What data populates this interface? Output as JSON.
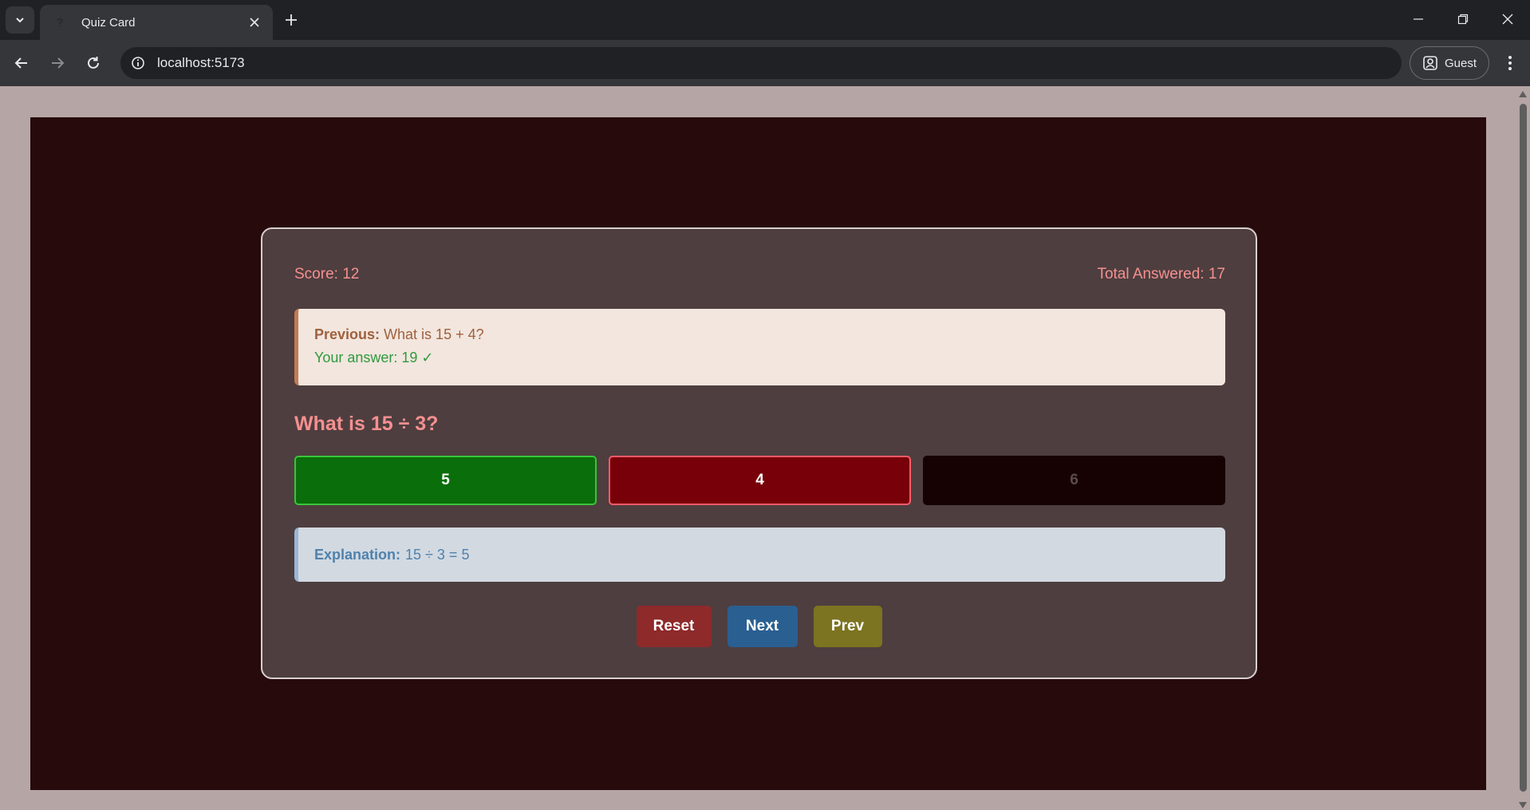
{
  "browser": {
    "tab_title": "Quiz Card",
    "tab_favicon": "?",
    "url": "localhost:5173",
    "profile_label": "Guest"
  },
  "quiz": {
    "score_text": "Score: 12",
    "total_text": "Total Answered: 17",
    "previous": {
      "label": "Previous:",
      "question": "What is 15 + 4?",
      "answer_text": "Your answer: 19 ✓"
    },
    "question": "What is 15 ÷ 3?",
    "answers": [
      {
        "label": "5",
        "state": "correct"
      },
      {
        "label": "4",
        "state": "wrong"
      },
      {
        "label": "6",
        "state": "disabled"
      }
    ],
    "explanation": {
      "label": "Explanation:",
      "text": "15 ÷ 3 = 5"
    },
    "buttons": {
      "reset": "Reset",
      "next": "Next",
      "prev": "Prev"
    }
  },
  "colors": {
    "correct": "#0a6e0a",
    "wrong": "#780008",
    "accent_text": "#f59090"
  }
}
